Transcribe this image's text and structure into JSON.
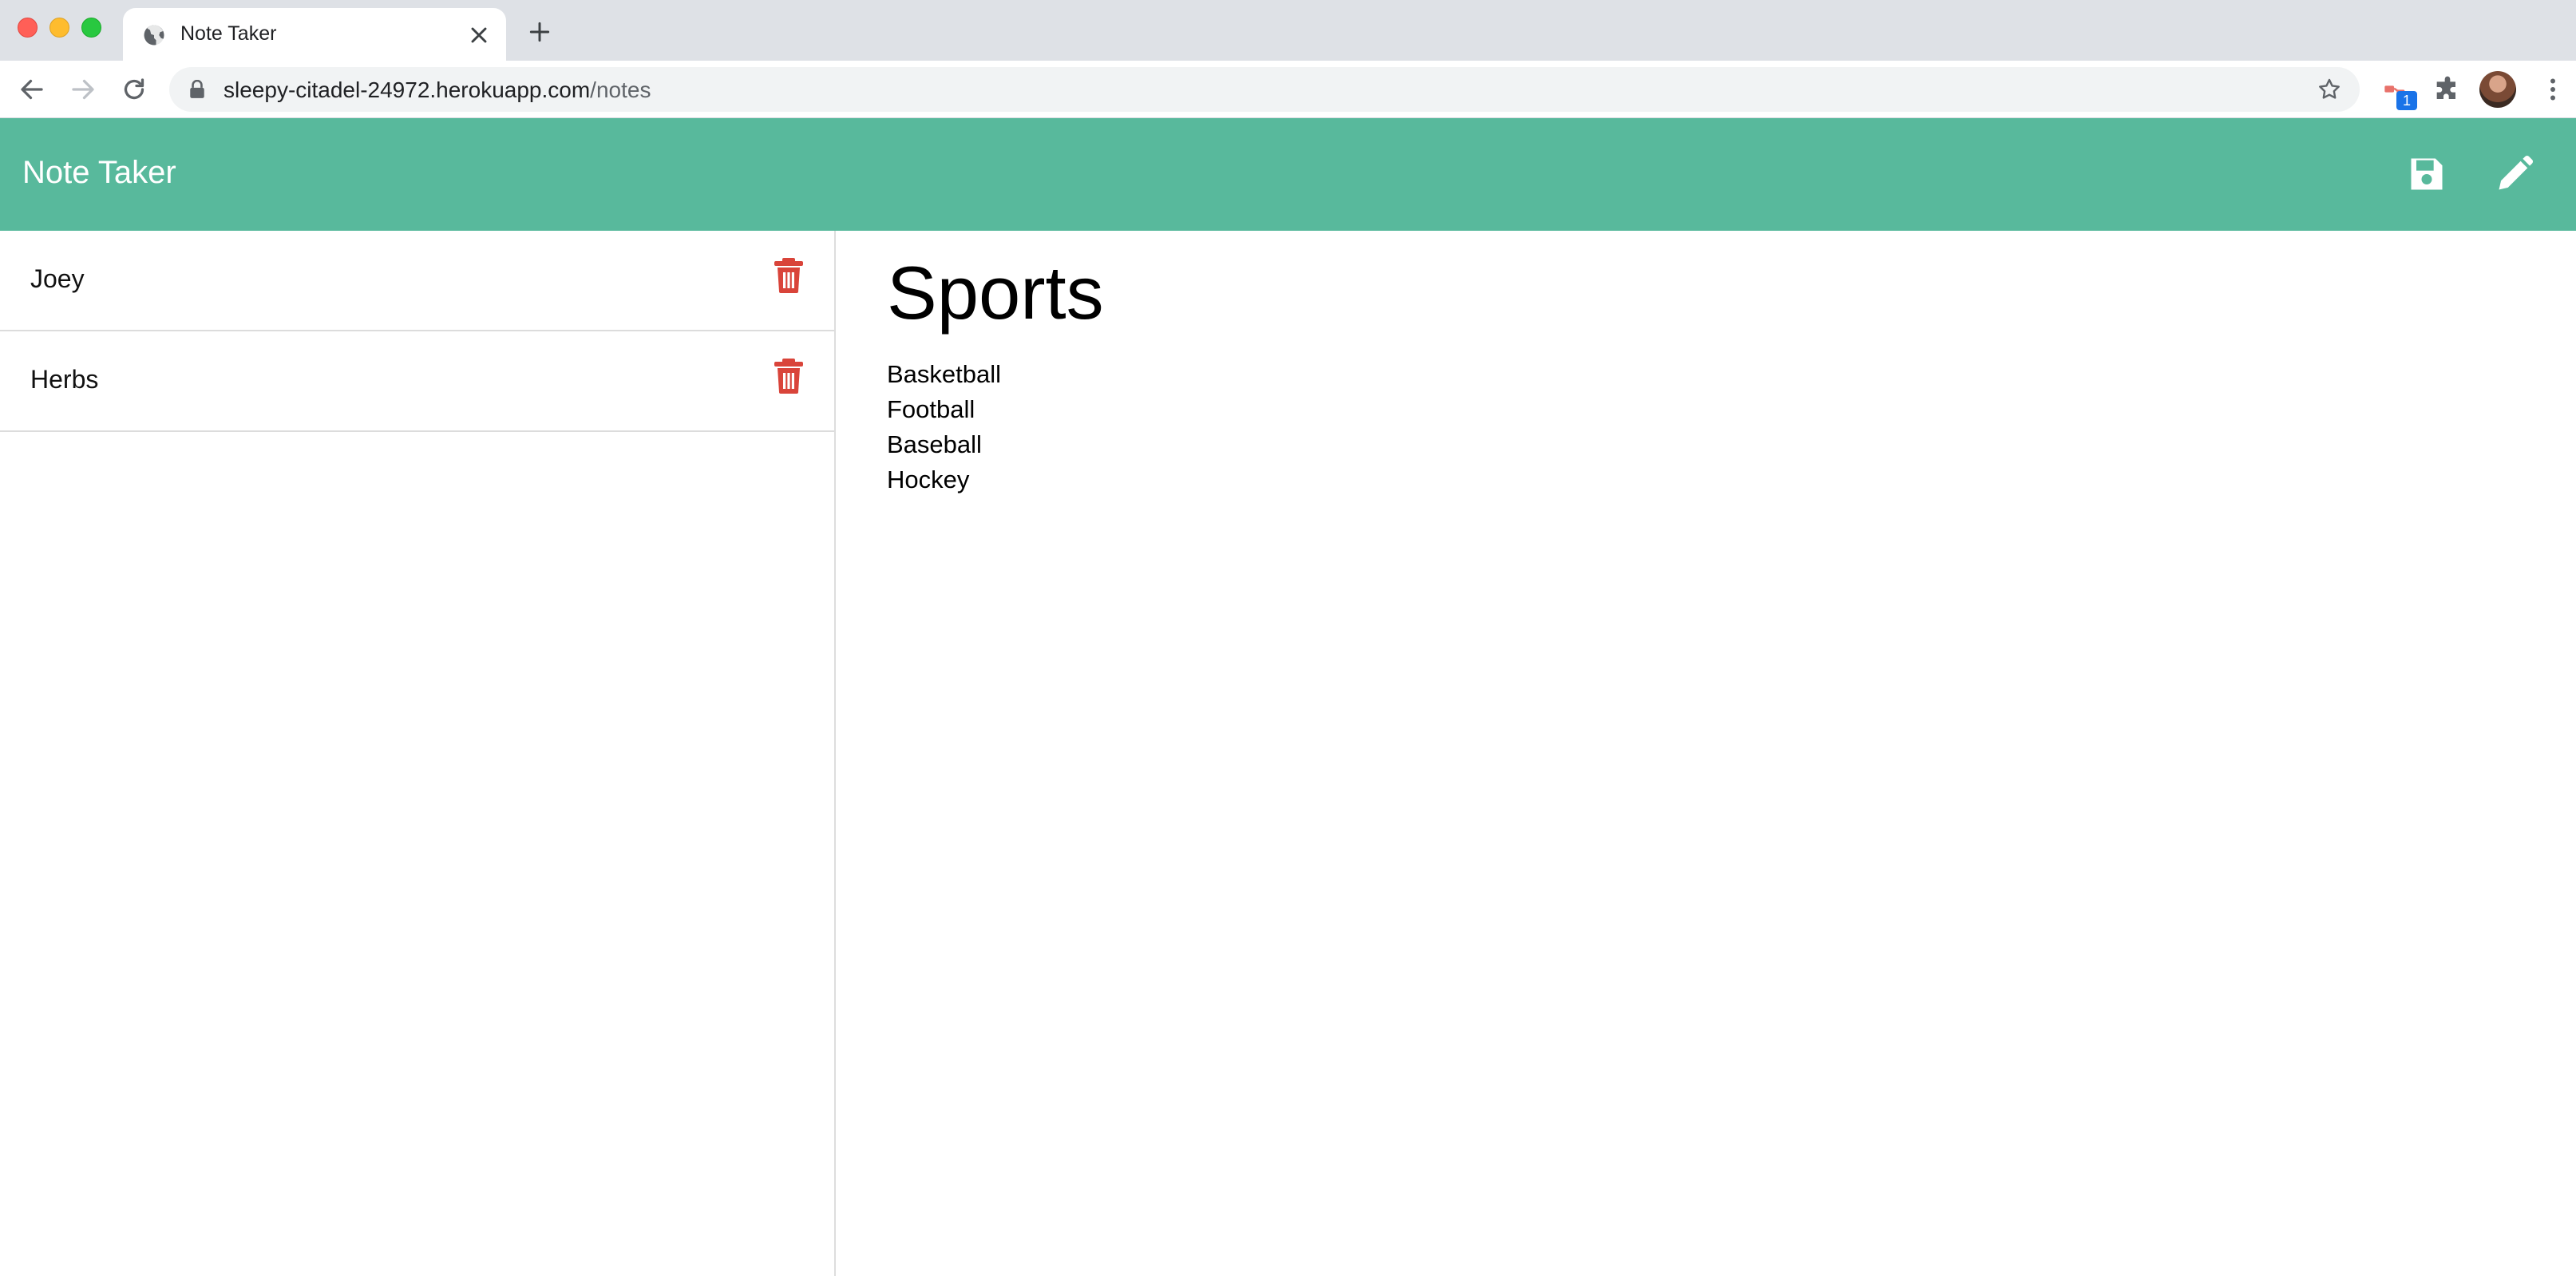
{
  "browser": {
    "tab_title": "Note Taker",
    "url_host": "sleepy-citadel-24972.herokuapp.com",
    "url_path": "/notes",
    "extension_badge": "1"
  },
  "app": {
    "title": "Note Taker",
    "accent_color": "#58b99c",
    "delete_color": "#d9443a"
  },
  "notes": [
    {
      "title": "Joey"
    },
    {
      "title": "Herbs"
    }
  ],
  "active_note": {
    "title": "Sports",
    "lines": [
      "Basketball",
      "Football",
      "Baseball",
      "Hockey"
    ]
  },
  "icons": {
    "save": "save-icon",
    "write": "pencil-icon",
    "delete": "trash-icon"
  }
}
